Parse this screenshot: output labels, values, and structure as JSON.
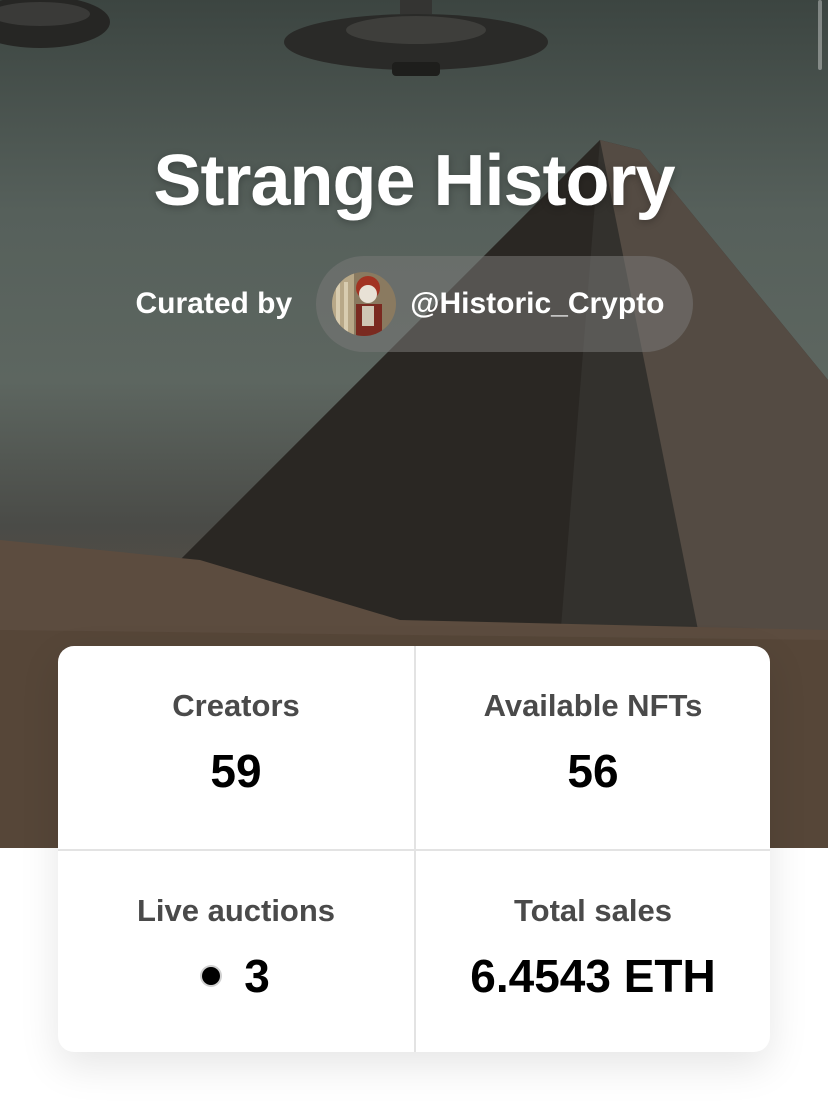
{
  "collection": {
    "title": "Strange History",
    "curated_by_label": "Curated by",
    "curator_handle": "@Historic_Crypto"
  },
  "stats": {
    "creators": {
      "label": "Creators",
      "value": "59"
    },
    "available_nfts": {
      "label": "Available NFTs",
      "value": "56"
    },
    "live_auctions": {
      "label": "Live auctions",
      "value": "3"
    },
    "total_sales": {
      "label": "Total sales",
      "value": "6.4543 ETH"
    }
  }
}
